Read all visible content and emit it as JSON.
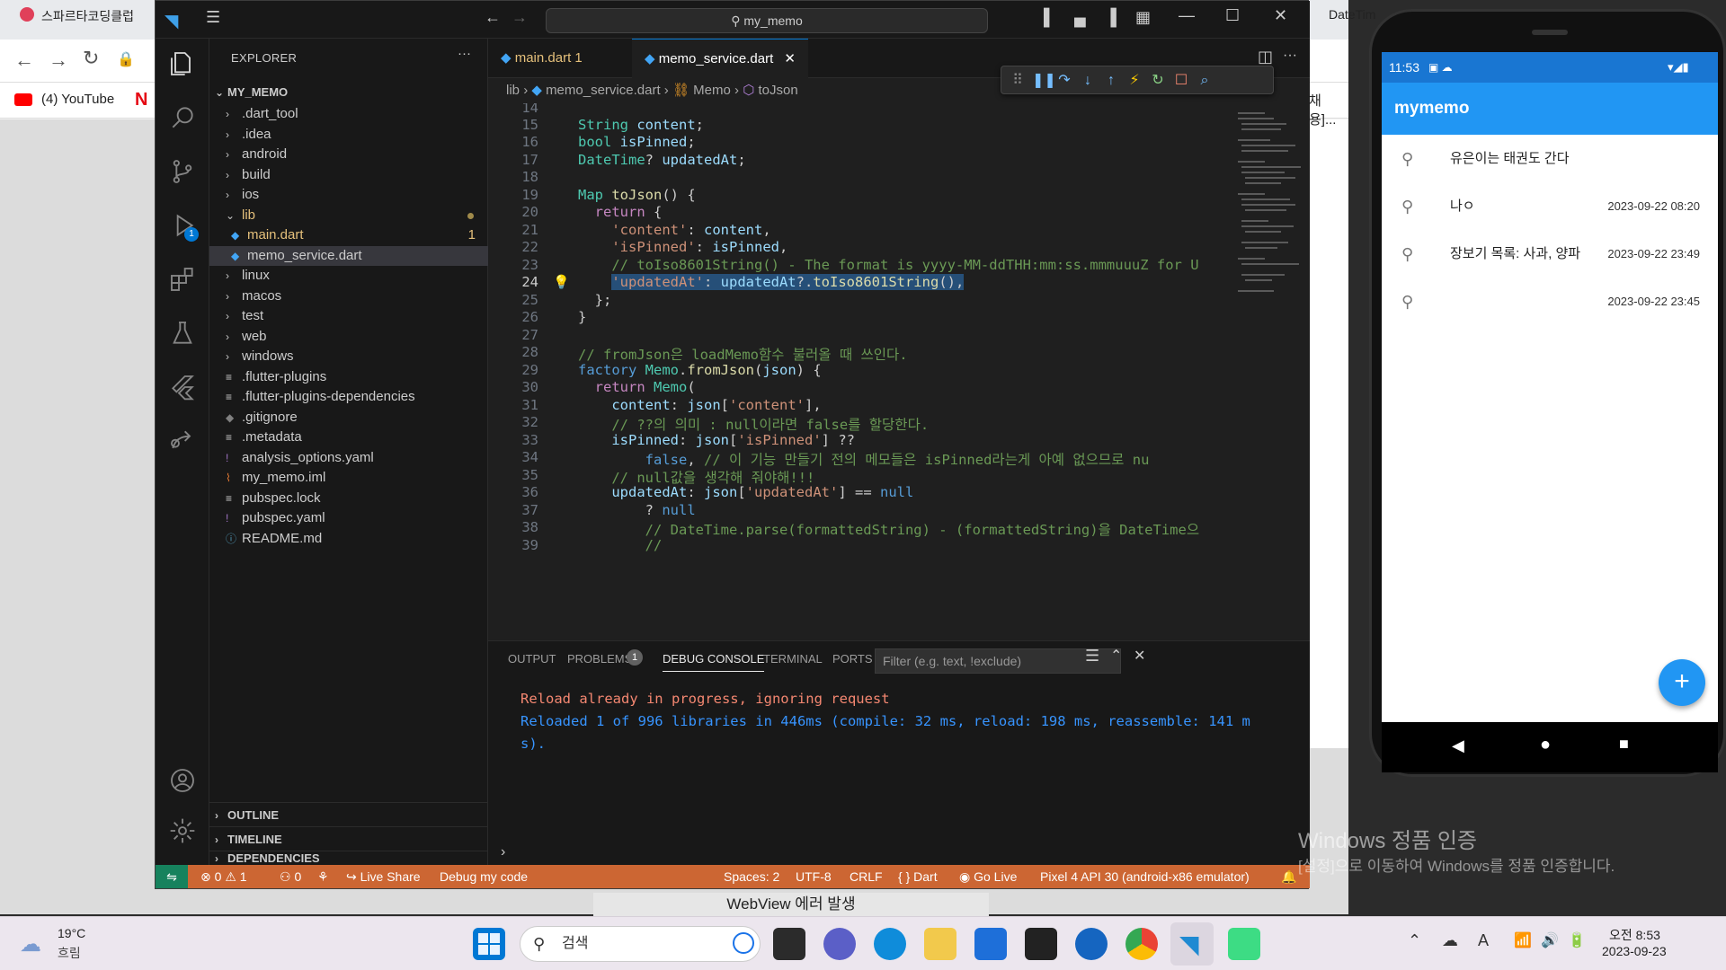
{
  "browser": {
    "tab_label": "스파르타코딩클럽",
    "tab2_label": "DateTim",
    "bookmark_youtube": "(4) YouTube",
    "partial_text": "채용]..."
  },
  "vscode": {
    "command_center": "my_memo",
    "explorer_title": "EXPLORER",
    "root_folder": "MY_MEMO",
    "tree": [
      {
        "label": ".dart_tool",
        "type": "folder",
        "depth": 1
      },
      {
        "label": ".idea",
        "type": "folder",
        "depth": 1
      },
      {
        "label": "android",
        "type": "folder",
        "depth": 1
      },
      {
        "label": "build",
        "type": "folder",
        "depth": 1
      },
      {
        "label": "ios",
        "type": "folder",
        "depth": 1
      },
      {
        "label": "lib",
        "type": "folder-open",
        "depth": 1
      },
      {
        "label": "main.dart",
        "type": "dart",
        "depth": 2,
        "badge": "1"
      },
      {
        "label": "memo_service.dart",
        "type": "dart",
        "depth": 2
      },
      {
        "label": "linux",
        "type": "folder",
        "depth": 1
      },
      {
        "label": "macos",
        "type": "folder",
        "depth": 1
      },
      {
        "label": "test",
        "type": "folder",
        "depth": 1
      },
      {
        "label": "web",
        "type": "folder",
        "depth": 1
      },
      {
        "label": "windows",
        "type": "folder",
        "depth": 1
      },
      {
        "label": ".flutter-plugins",
        "type": "file",
        "depth": 1
      },
      {
        "label": ".flutter-plugins-dependencies",
        "type": "file",
        "depth": 1
      },
      {
        "label": ".gitignore",
        "type": "git",
        "depth": 1
      },
      {
        "label": ".metadata",
        "type": "file",
        "depth": 1
      },
      {
        "label": "analysis_options.yaml",
        "type": "yaml",
        "depth": 1
      },
      {
        "label": "my_memo.iml",
        "type": "rss",
        "depth": 1
      },
      {
        "label": "pubspec.lock",
        "type": "file",
        "depth": 1
      },
      {
        "label": "pubspec.yaml",
        "type": "yaml",
        "depth": 1
      },
      {
        "label": "README.md",
        "type": "info",
        "depth": 1
      }
    ],
    "outline_label": "OUTLINE",
    "timeline_label": "TIMELINE",
    "dependencies_label": "DEPENDENCIES",
    "tabs": [
      {
        "label": "main.dart",
        "badge": "1"
      },
      {
        "label": "memo_service.dart"
      }
    ],
    "breadcrumb": {
      "folder": "lib",
      "file": "memo_service.dart",
      "cls": "Memo",
      "method": "toJson"
    },
    "panel_tabs": {
      "output": "OUTPUT",
      "problems": "PROBLEMS",
      "problems_count": "1",
      "debug_console": "DEBUG CONSOLE",
      "terminal": "TERMINAL",
      "ports": "PORTS"
    },
    "filter_placeholder": "Filter (e.g. text, !exclude)",
    "console": [
      "Reload already in progress, ignoring request",
      "Reloaded 1 of 996 libraries in 446ms (compile: 32 ms, reload: 198 ms, reassemble: 141 m",
      "s)."
    ],
    "status": {
      "errors": "0",
      "warnings": "1",
      "ports": "0",
      "live_share": "Live Share",
      "debug": "Debug my code",
      "spaces": "Spaces: 2",
      "encoding": "UTF-8",
      "eol": "CRLF",
      "language": "Dart",
      "go_live": "Go Live",
      "device": "Pixel 4 API 30 (android-x86 emulator)"
    },
    "activity_badge": "1"
  },
  "phone": {
    "time": "11:53",
    "app_title": "mymemo",
    "memos": [
      {
        "text": "유은이는 태권도 간다",
        "date": ""
      },
      {
        "text": "나ㅇ",
        "date": "2023-09-22 08:20"
      },
      {
        "text": "장보기 목록: 사과, 양파",
        "date": "2023-09-22 23:49"
      },
      {
        "text": "",
        "date": "2023-09-22 23:45"
      }
    ],
    "fab": "+"
  },
  "watermark": {
    "line1": "Windows 정품 인증",
    "line2": "[설정]으로 이동하여 Windows를 정품 인증합니다."
  },
  "behind_text": "WebView 에러 발생",
  "taskbar": {
    "weather_temp": "19°C",
    "weather_desc": "흐림",
    "search": "검색",
    "time": "오전 8:53",
    "date": "2023-09-23"
  },
  "colors": {
    "statusbar": "#cc6633",
    "phone_appbar": "#2196f3",
    "vscode_bg": "#1f1f1f"
  }
}
